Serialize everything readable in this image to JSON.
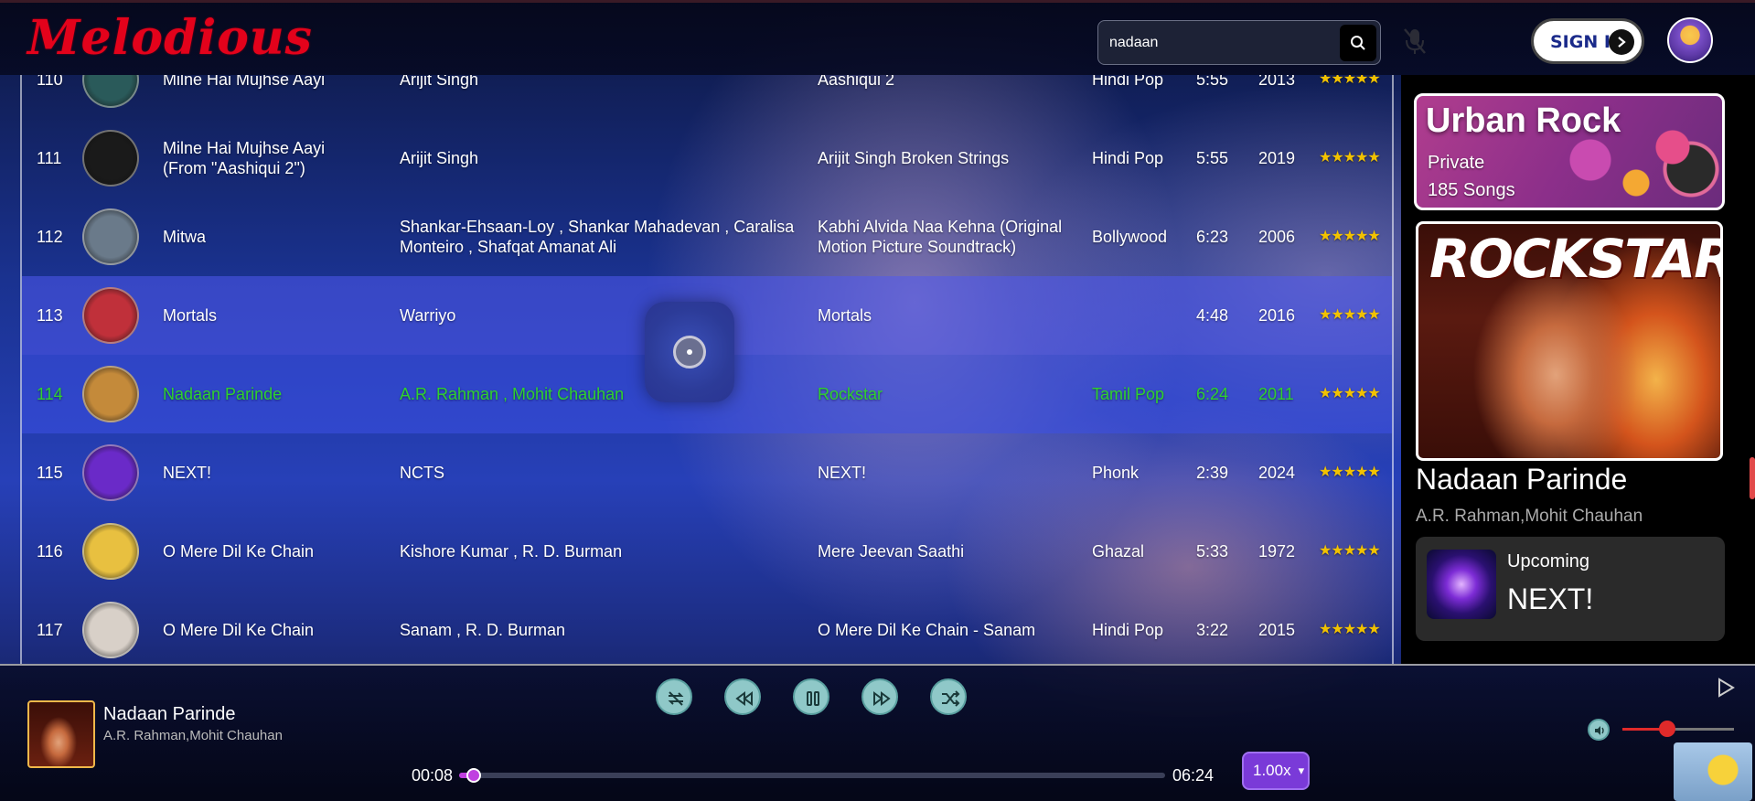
{
  "app": {
    "logo": "Melodious"
  },
  "header": {
    "search_value": "nadaan",
    "signin_label": "SIGN IN"
  },
  "songs": [
    {
      "num": "110",
      "title": "Milne Hai Mujhse Aayi",
      "artist": "Arijit Singh",
      "album": "Aashiqui 2",
      "genre": "Hindi Pop",
      "duration": "5:55",
      "year": "2013",
      "rating": "★★★★★",
      "thumb_color": "#2a5a5a"
    },
    {
      "num": "111",
      "title": "Milne Hai Mujhse Aayi (From \"Aashiqui 2\")",
      "artist": "Arijit Singh",
      "album": "Arijit Singh Broken Strings",
      "genre": "Hindi Pop",
      "duration": "5:55",
      "year": "2019",
      "rating": "★★★★★",
      "thumb_color": "#1a1a1a"
    },
    {
      "num": "112",
      "title": "Mitwa",
      "artist": "Shankar-Ehsaan-Loy , Shankar Mahadevan , Caralisa Monteiro , Shafqat Amanat Ali",
      "album": "Kabhi Alvida Naa Kehna (Original Motion Picture Soundtrack)",
      "genre": "Bollywood",
      "duration": "6:23",
      "year": "2006",
      "rating": "★★★★★",
      "thumb_color": "#6a7a8a"
    },
    {
      "num": "113",
      "title": "Mortals",
      "artist": "Warriyo",
      "album": "Mortals",
      "genre": "",
      "duration": "4:48",
      "year": "2016",
      "rating": "★★★★★",
      "thumb_color": "#c0303a"
    },
    {
      "num": "114",
      "title": "Nadaan Parinde",
      "artist": "A.R. Rahman , Mohit Chauhan",
      "album": "Rockstar",
      "genre": "Tamil Pop",
      "duration": "6:24",
      "year": "2011",
      "rating": "★★★★★",
      "thumb_color": "#c48a3a"
    },
    {
      "num": "115",
      "title": "NEXT!",
      "artist": "NCTS",
      "album": "NEXT!",
      "genre": "Phonk",
      "duration": "2:39",
      "year": "2024",
      "rating": "★★★★★",
      "thumb_color": "#6a2ac8"
    },
    {
      "num": "116",
      "title": "O Mere Dil Ke Chain",
      "artist": "Kishore Kumar , R. D. Burman",
      "album": "Mere Jeevan Saathi",
      "genre": "Ghazal",
      "duration": "5:33",
      "year": "1972",
      "rating": "★★★★★",
      "thumb_color": "#e8c040"
    },
    {
      "num": "117",
      "title": "O Mere Dil Ke Chain",
      "artist": "Sanam , R. D. Burman",
      "album": "O Mere Dil Ke Chain - Sanam",
      "genre": "Hindi Pop",
      "duration": "3:22",
      "year": "2015",
      "rating": "★★★★★",
      "thumb_color": "#d8d0c8"
    }
  ],
  "playing_index": 4,
  "hover_index": 3,
  "side_panel": {
    "playlist": {
      "name": "Urban Rock",
      "privacy": "Private",
      "count": "185 Songs"
    },
    "album_art_text": "ROCKSTAR",
    "now_playing": {
      "title": "Nadaan Parinde",
      "artist": "A.R. Rahman,Mohit Chauhan"
    },
    "upcoming": {
      "label": "Upcoming",
      "title": "NEXT!"
    }
  },
  "player": {
    "title": "Nadaan Parinde",
    "artist": "A.R. Rahman,Mohit Chauhan",
    "current_time": "00:08",
    "total_time": "06:24",
    "progress": 0.021,
    "speed": "1.00x",
    "volume": 0.4,
    "controls": [
      "repeat-icon",
      "rewind-icon",
      "pause-icon",
      "forward-icon",
      "shuffle-icon"
    ]
  },
  "colors": {
    "logo": "#e3021b",
    "playing_text": "#2fd12f",
    "stars": "#f2c200",
    "progress": "#c040e0",
    "volume": "#e02a2a",
    "speed_button": "#7a3ad8"
  }
}
